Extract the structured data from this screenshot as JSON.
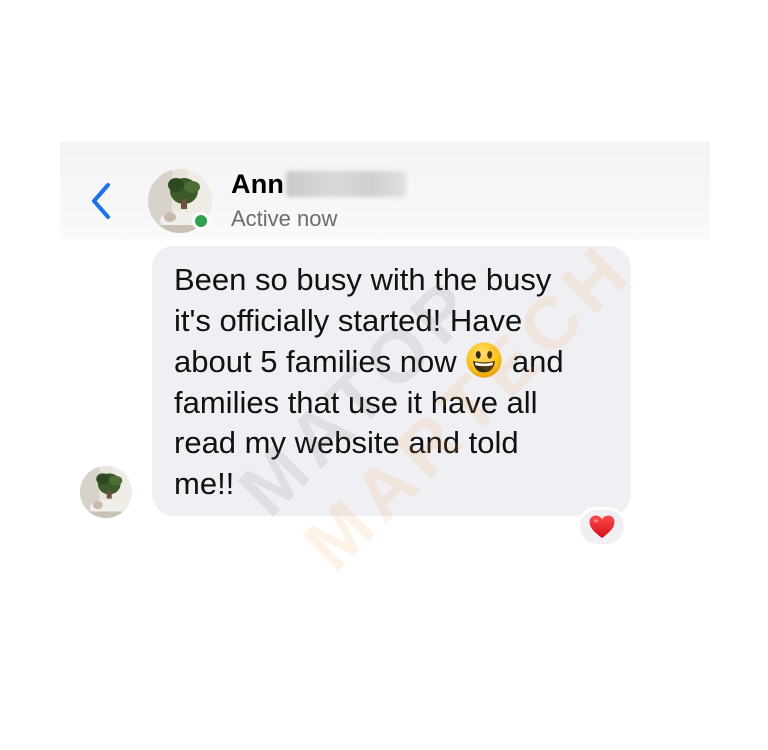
{
  "colors": {
    "accent_blue": "#1a73e8",
    "presence_green": "#31a24c",
    "bubble_bg": "#efeff4",
    "reaction_red": "#e0202f"
  },
  "header": {
    "back_icon": "chevron-left-icon",
    "contact_name": "Ann",
    "status": "Active now"
  },
  "message": {
    "lines": [
      "Been so busy with the busy",
      "it's officially started! Have",
      "about 5 families now",
      "and",
      "families that use it have all",
      "read my website and told",
      "me!!"
    ],
    "inline_emoji": "grinning-face-icon",
    "reaction_icon": "red-heart-icon"
  },
  "watermark": {
    "line1": "MATOP",
    "line2": "MARTECH"
  }
}
